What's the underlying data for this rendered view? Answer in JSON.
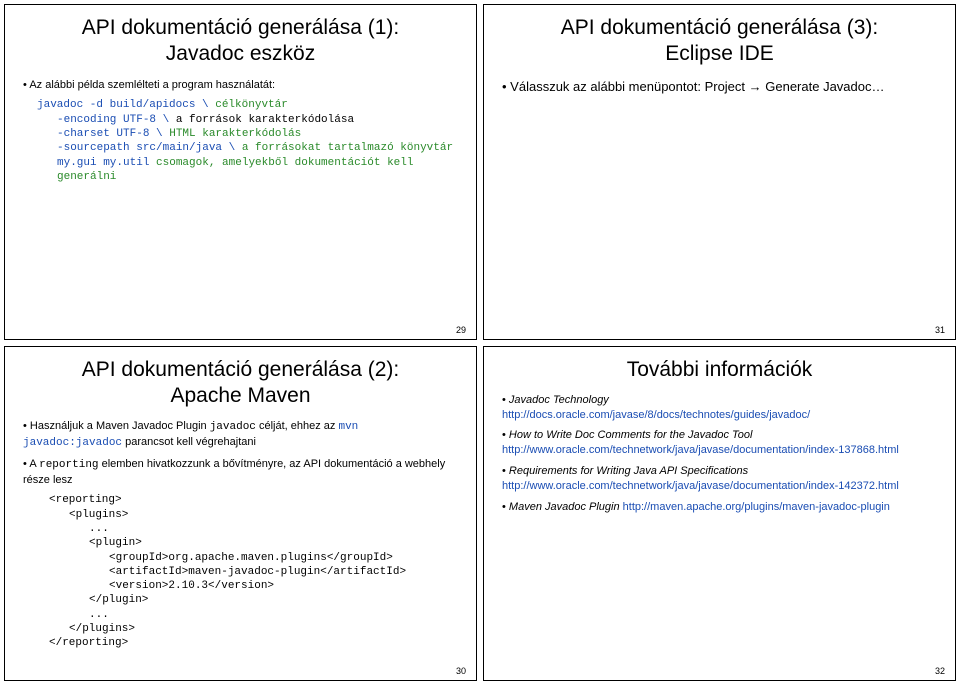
{
  "slides": {
    "s29": {
      "title_l1": "API dokumentáció generálása (1):",
      "title_l2": "Javadoc eszköz",
      "bullet1": "Az alábbi példa szemlélteti a program használatát:",
      "code": {
        "l1a": "javadoc -d build/apidocs \\ ",
        "l1b": "célkönyvtár",
        "l2a": "-encoding UTF-8 \\ ",
        "l2b": "a források karakterkódolása",
        "l3a": "-charset UTF-8 \\ ",
        "l3b": "HTML karakterkódolás",
        "l4a": "-sourcepath src/main/java \\ ",
        "l4b": "a forrásokat tartalmazó könyvtár",
        "l5a": "my.gui my.util ",
        "l5b": "csomagok, amelyekből dokumentációt kell generálni"
      },
      "page": "29"
    },
    "s31": {
      "title_l1": "API dokumentáció generálása (3):",
      "title_l2": "Eclipse IDE",
      "bullet1a": "Válasszuk az alábbi menüpontot: Project ",
      "bullet1b": " Generate Javadoc…",
      "page": "31"
    },
    "s30": {
      "title_l1": "API dokumentáció generálása (2):",
      "title_l2": "Apache Maven",
      "b1p1": "Használjuk a Maven Javadoc Plugin ",
      "b1p2": "javadoc",
      "b1p3": " célját, ehhez az ",
      "b1p4": "mvn javadoc:javadoc",
      "b1p5": " parancsot kell végrehajtani",
      "b2p1": "A ",
      "b2p2": "reporting",
      "b2p3": " elemben hivatkozzunk a bővítményre, az API dokumentáció a webhely része lesz",
      "code": {
        "l1": "<reporting>",
        "l2": "<plugins>",
        "l3": "...",
        "l4": "<plugin>",
        "l5": "<groupId>org.apache.maven.plugins</groupId>",
        "l6": "<artifactId>maven-javadoc-plugin</artifactId>",
        "l7": "<version>2.10.3</version>",
        "l8": "</plugin>",
        "l9": "...",
        "l10": "</plugins>",
        "l11": "</reporting>"
      },
      "page": "30"
    },
    "s32": {
      "title": "További információk",
      "i1l": "Javadoc Technology",
      "i1u": "http://docs.oracle.com/javase/8/docs/technotes/guides/javadoc/",
      "i2l": "How to Write Doc Comments for the Javadoc Tool",
      "i2u": "http://www.oracle.com/technetwork/java/javase/documentation/index-137868.html",
      "i3l": "Requirements for Writing Java API Specifications",
      "i3u": "http://www.oracle.com/technetwork/java/javase/documentation/index-142372.html",
      "i4l": "Maven Javadoc Plugin ",
      "i4u": "http://maven.apache.org/plugins/maven-javadoc-plugin",
      "page": "32"
    }
  }
}
